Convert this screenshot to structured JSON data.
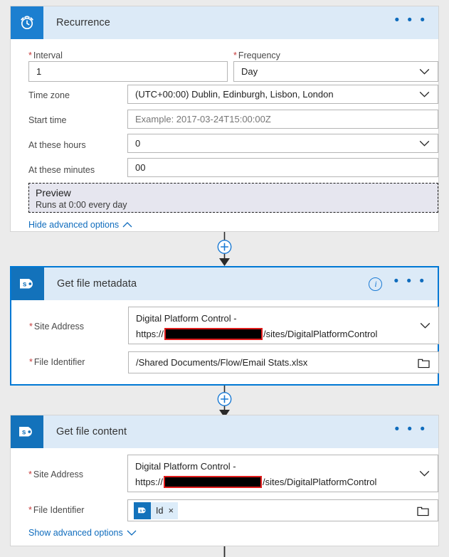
{
  "cards": [
    {
      "id": "recurrence",
      "title": "Recurrence",
      "icon": "alarm-clock-icon",
      "selected": false,
      "fields": {
        "interval_label": "Interval",
        "interval_value": "1",
        "frequency_label": "Frequency",
        "frequency_value": "Day",
        "timezone_label": "Time zone",
        "timezone_value": "(UTC+00:00) Dublin, Edinburgh, Lisbon, London",
        "starttime_label": "Start time",
        "starttime_placeholder": "Example: 2017-03-24T15:00:00Z",
        "athours_label": "At these hours",
        "athours_value": "0",
        "atminutes_label": "At these minutes",
        "atminutes_value": "00"
      },
      "preview": {
        "title": "Preview",
        "text": "Runs at 0:00 every day"
      },
      "advanced_link": "Hide advanced options"
    },
    {
      "id": "get-file-metadata",
      "title": "Get file metadata",
      "icon": "sharepoint-icon",
      "selected": true,
      "fields": {
        "site_address_label": "Site Address",
        "site_address_line1": "Digital Platform Control -",
        "site_address_prefix": "https://",
        "site_address_suffix": "/sites/DigitalPlatformControl",
        "file_identifier_label": "File Identifier",
        "file_identifier_value": "/Shared Documents/Flow/Email Stats.xlsx"
      }
    },
    {
      "id": "get-file-content",
      "title": "Get file content",
      "icon": "sharepoint-icon",
      "selected": false,
      "fields": {
        "site_address_label": "Site Address",
        "site_address_line1": "Digital Platform Control -",
        "site_address_prefix": "https://",
        "site_address_suffix": "/sites/DigitalPlatformControl",
        "file_identifier_label": "File Identifier",
        "file_identifier_token": "Id",
        "file_identifier_token_remove": "×"
      },
      "advanced_link": "Show advanced options"
    }
  ],
  "icons": {
    "more_commands": "• • •",
    "info": "i",
    "add_step": "+",
    "folder": "folder-icon",
    "chevron_down": "chevron-down-icon",
    "chevron_up": "chevron-up-icon"
  },
  "colors": {
    "accent": "#0078d4",
    "card_header": "#dceaf7",
    "icon_tile_trigger": "#1c7fd0",
    "icon_tile_sharepoint": "#1372bb",
    "required_asterisk": "#c63a3a",
    "link": "#0f6cbd",
    "canvas": "#ebebeb",
    "redaction_border": "#e01b1b",
    "preview_bg": "#e6e6ef"
  }
}
